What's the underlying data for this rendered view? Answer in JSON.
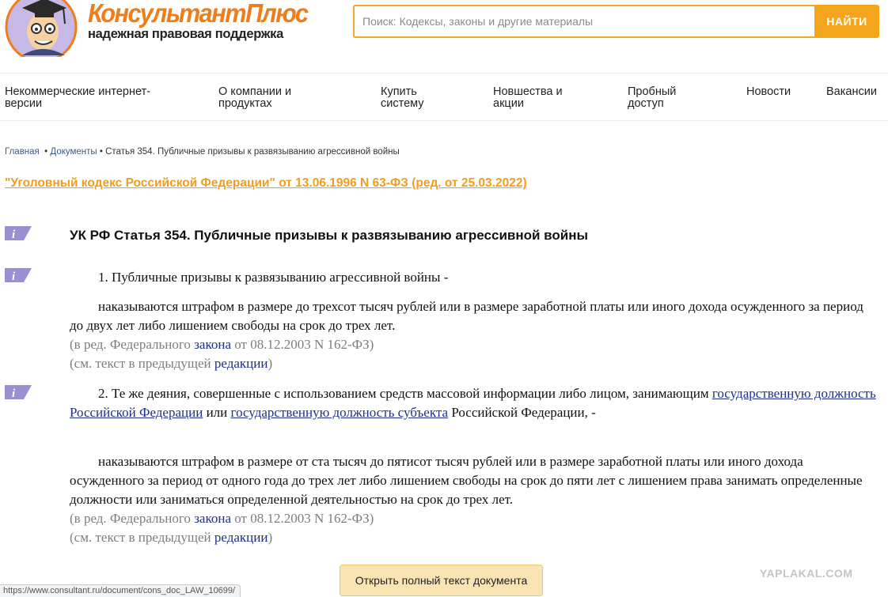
{
  "header": {
    "logo_title": "КонсультантПлюс",
    "logo_subtitle": "надежная правовая поддержка",
    "search_placeholder": "Поиск: Кодексы, законы и другие материалы",
    "search_button": "НАЙТИ",
    "brand_color": "#f07d1c",
    "button_color": "#f5a51c"
  },
  "nav": [
    {
      "l1": "Некоммерческие интернет-",
      "l2": "версии"
    },
    {
      "l1": "О компании и",
      "l2": "продуктах"
    },
    {
      "l1": "Купить",
      "l2": "систему"
    },
    {
      "l1": "Новшества и",
      "l2": "акции"
    },
    {
      "l1": "Пробный",
      "l2": "доступ"
    },
    {
      "l1": "Новости",
      "l2": ""
    },
    {
      "l1": "Вакансии",
      "l2": ""
    }
  ],
  "breadcrumb": {
    "home": "Главная",
    "sep1": "•",
    "docs": "Документы",
    "sep2": "•",
    "current": "Статья 354. Публичные призывы к развязыванию агрессивной войны"
  },
  "doc_link": "\"Уголовный кодекс Российской Федерации\" от 13.06.1996 N 63-ФЗ (ред. от 25.03.2022)",
  "article": {
    "title": "УК РФ Статья 354. Публичные призывы к развязыванию агрессивной войны",
    "p1": "1. Публичные призывы к развязыванию агрессивной войны -",
    "p1_sanction": "наказываются штрафом в размере до трехсот тысяч рублей или в размере заработной платы или иного дохода осужденного за период до двух лет либо лишением свободы на срок до трех лет.",
    "ed_prefix": "(в ред. Федерального ",
    "ed_link": "закона",
    "ed_suffix": " от 08.12.2003 N 162-ФЗ)",
    "see_prefix": "(см. текст в предыдущей ",
    "see_link": "редакции",
    "see_suffix": ")",
    "p2_start": "2. Те же деяния, совершенные с использованием средств массовой информации либо лицом, занимающим ",
    "p2_link1": "государственную должность Российской Федерации",
    "p2_or": " или ",
    "p2_link2": "государственную должность субъекта",
    "p2_end": " Российской Федерации, -",
    "p2_sanction": "наказываются штрафом в размере от ста тысяч до пятисот тысяч рублей или в размере заработной платы или иного дохода осужденного за период от одного года до трех лет либо лишением свободы на срок до пяти лет с лишением права занимать определенные должности или заниматься определенной деятельностью на срок до трех лет."
  },
  "open_button": "Открыть полный текст документа",
  "status_url": "https://www.consultant.ru/document/cons_doc_LAW_10699/",
  "watermark": "YAPLAKAL.COM",
  "info_icon_color": "#9b8ed1"
}
